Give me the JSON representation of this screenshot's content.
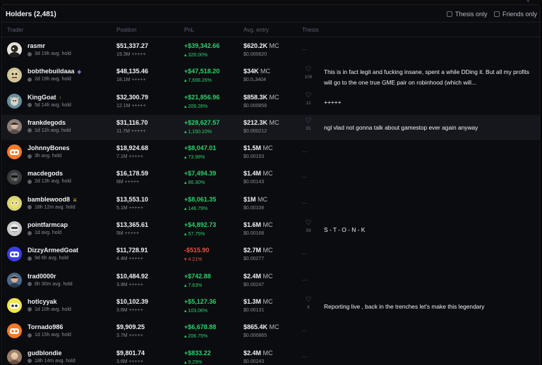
{
  "panel": {
    "title": "Holders (2,481)",
    "filters": {
      "thesis_only": "Thesis only",
      "friends_only": "Friends only"
    }
  },
  "columns": {
    "trader": "Trader",
    "position": "Position",
    "pnl": "PnL",
    "avg_entry": "Avg. entry",
    "thesis": "Thesis"
  },
  "colors": {
    "panel_bg": "#0b0c10",
    "positive": "#2fd06a",
    "negative": "#e4553b",
    "muted": "#8b8d99"
  },
  "rows": [
    {
      "name": "rasmr",
      "hold": "3d 19h avg. hold",
      "position": "$51,337.27",
      "tokens": "19.3M +++++",
      "pnl": "+$39,342.66",
      "pnl_pct": "328.00%",
      "mc": "$620.2K",
      "mc_unit": "MC",
      "entry": "$0.000620",
      "thesis": "",
      "likes": ""
    },
    {
      "name": "bobthebuildaaa",
      "badge": "verified-badge-icon",
      "hold": "2d 19h avg. hold",
      "position": "$48,135.46",
      "tokens": "18.1M +++++",
      "pnl": "+$47,518.20",
      "pnl_pct": "7,698.26%",
      "mc": "$34K",
      "mc_unit": "MC",
      "entry": "$0.0₄3404",
      "thesis": "This is in fact legit and fucking insane, spent a while DDing it. But all my profits will go to the one true GME pair on robinhood (which will...",
      "likes": "106"
    },
    {
      "name": "KingGoat",
      "badge": "arrow-up-icon",
      "hold": "5d 14h avg. hold",
      "position": "$32,300.79",
      "tokens": "12.1M +++++",
      "pnl": "+$21,856.96",
      "pnl_pct": "209.28%",
      "mc": "$858.3K",
      "mc_unit": "MC",
      "entry": "$0.000858",
      "thesis": "+++++",
      "likes": "12"
    },
    {
      "name": "frankdegods",
      "hold": "1d 11h avg. hold",
      "position": "$31,116.70",
      "tokens": "11.7M +++++",
      "pnl": "+$28,627.57",
      "pnl_pct": "1,150.10%",
      "mc": "$212.3K",
      "mc_unit": "MC",
      "entry": "$0.000212",
      "thesis": "ngl vlad not gonna talk about gamestop ever again anyway",
      "likes": "91"
    },
    {
      "name": "JohnnyBones",
      "hold": "3h avg. hold",
      "position": "$18,924.68",
      "tokens": "7.1M +++++",
      "pnl": "+$8,047.01",
      "pnl_pct": "73.98%",
      "mc": "$1.5M",
      "mc_unit": "MC",
      "entry": "$0.00153",
      "thesis": "",
      "likes": ""
    },
    {
      "name": "macdegods",
      "hold": "2d 13h avg. hold",
      "position": "$16,178.59",
      "tokens": "6M +++++",
      "pnl": "+$7,494.39",
      "pnl_pct": "86.30%",
      "mc": "$1.4M",
      "mc_unit": "MC",
      "entry": "$0.00143",
      "thesis": "",
      "likes": ""
    },
    {
      "name": "bamblewood8",
      "badge": "crossed-swords-icon",
      "hold": "18h 12m avg. hold",
      "position": "$13,553.10",
      "tokens": "5.1M +++++",
      "pnl": "+$8,061.35",
      "pnl_pct": "146.79%",
      "mc": "$1M",
      "mc_unit": "MC",
      "entry": "$0.00108",
      "thesis": "",
      "likes": ""
    },
    {
      "name": "pointfarmcap",
      "hold": "1d avg. hold",
      "position": "$13,365.61",
      "tokens": "5M +++++",
      "pnl": "+$4,892.73",
      "pnl_pct": "57.75%",
      "mc": "$1.6M",
      "mc_unit": "MC",
      "entry": "$0.00168",
      "thesis": "S - T - O - N - K",
      "likes": "59"
    },
    {
      "name": "DizzyArmedGoat",
      "hold": "9d 6h avg. hold",
      "position": "$11,728.91",
      "tokens": "4.4M +++++",
      "pnl": "-$515.90",
      "pnl_pct": "4.21%",
      "mc": "$2.7M",
      "mc_unit": "MC",
      "entry": "$0.00277",
      "thesis": "",
      "likes": "",
      "negative": true
    },
    {
      "name": "trad0000r",
      "hold": "6h 30m avg. hold",
      "position": "$10,484.92",
      "tokens": "3.9M +++++",
      "pnl": "+$742.88",
      "pnl_pct": "7.63%",
      "mc": "$2.4M",
      "mc_unit": "MC",
      "entry": "$0.00247",
      "thesis": "",
      "likes": ""
    },
    {
      "name": "hotlcyyak",
      "hold": "1d 10h avg. hold",
      "position": "$10,102.39",
      "tokens": "3.8M +++++",
      "pnl": "+$5,127.36",
      "pnl_pct": "103.06%",
      "mc": "$1.3M",
      "mc_unit": "MC",
      "entry": "$0.00131",
      "thesis": "Reporting live , back in the trenches let's make this legendary",
      "likes": "6"
    },
    {
      "name": "Tornado986",
      "hold": "1d 15h avg. hold",
      "position": "$9,909.25",
      "tokens": "3.7M +++++",
      "pnl": "+$6,678.88",
      "pnl_pct": "206.75%",
      "mc": "$865.4K",
      "mc_unit": "MC",
      "entry": "$0.000865",
      "thesis": "",
      "likes": ""
    },
    {
      "name": "gudblondie",
      "hold": "18h 14m avg. hold",
      "position": "$9,801.74",
      "tokens": "3.6M +++++",
      "pnl": "+$833.22",
      "pnl_pct": "9.29%",
      "mc": "$2.4M",
      "mc_unit": "MC",
      "entry": "$0.00243",
      "thesis": "",
      "likes": ""
    }
  ]
}
